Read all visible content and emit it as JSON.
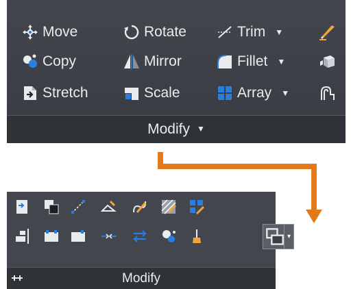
{
  "top_panel": {
    "rows": [
      [
        {
          "label": "Move",
          "icon": "move-icon"
        },
        {
          "label": "Rotate",
          "icon": "rotate-icon"
        },
        {
          "label": "Trim",
          "icon": "trim-icon",
          "has_dropdown": true
        },
        {
          "label": "",
          "icon": "erase-icon"
        }
      ],
      [
        {
          "label": "Copy",
          "icon": "copy-icon"
        },
        {
          "label": "Mirror",
          "icon": "mirror-icon"
        },
        {
          "label": "Fillet",
          "icon": "fillet-icon",
          "has_dropdown": true
        },
        {
          "label": "",
          "icon": "explode-icon"
        }
      ],
      [
        {
          "label": "Stretch",
          "icon": "stretch-icon"
        },
        {
          "label": "Scale",
          "icon": "scale-icon"
        },
        {
          "label": "Array",
          "icon": "array-icon",
          "has_dropdown": true
        },
        {
          "label": "",
          "icon": "offset-icon"
        }
      ]
    ],
    "footer_label": "Modify",
    "dropdown_arrow": "▼"
  },
  "bottom_panel": {
    "footer_label": "Modify",
    "pin_icon": "pin-icon",
    "rows": [
      [
        "icon-1",
        "icon-2",
        "icon-3",
        "icon-4",
        "icon-5",
        "icon-6",
        "icon-7"
      ],
      [
        "icon-8",
        "icon-9",
        "icon-10",
        "icon-11",
        "icon-12",
        "icon-13",
        "icon-14"
      ]
    ],
    "split_button_arrow": "▾"
  },
  "colors": {
    "panel_bg": "#43474d",
    "footer_bg": "#2f3338",
    "text": "#e9ecef",
    "connector": "#e2791a"
  }
}
